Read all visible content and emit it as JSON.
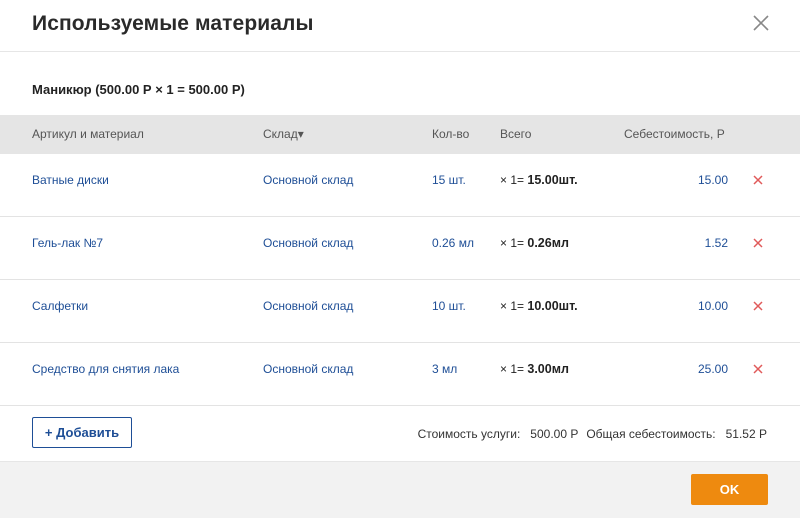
{
  "dialog": {
    "title": "Используемые материалы",
    "service_line": "Маникюр (500.00 Р × 1 = 500.00 Р)"
  },
  "table": {
    "columns": {
      "article": "Артикул и материал",
      "warehouse": "Склад",
      "warehouse_sort_icon": "▾",
      "qty": "Кол-во",
      "total": "Всего",
      "cost": "Себестоимость, Р"
    },
    "rows": [
      {
        "material": "Ватные диски",
        "warehouse": "Основной склад",
        "qty": "15 шт.",
        "mult": "× 1=",
        "total": "15.00шт.",
        "cost": "15.00"
      },
      {
        "material": "Гель-лак №7",
        "warehouse": "Основной склад",
        "qty": "0.26 мл",
        "mult": "× 1=",
        "total": "0.26мл",
        "cost": "1.52"
      },
      {
        "material": "Салфетки",
        "warehouse": "Основной склад",
        "qty": "10 шт.",
        "mult": "× 1=",
        "total": "10.00шт.",
        "cost": "10.00"
      },
      {
        "material": "Средство для снятия лака",
        "warehouse": "Основной склад",
        "qty": "3 мл",
        "mult": "× 1=",
        "total": "3.00мл",
        "cost": "25.00"
      }
    ]
  },
  "footer": {
    "add_label": "+ Добавить",
    "service_cost_label": "Стоимость услуги:",
    "service_cost_value": "500.00 Р",
    "total_cost_label": "Общая себестоимость:",
    "total_cost_value": "51.52 Р"
  },
  "actions": {
    "ok_label": "OK"
  },
  "colors": {
    "link": "#1e4e96",
    "delete": "#e05a5a",
    "ok": "#ee8a0f",
    "table_header_bg": "#e5e5e5"
  },
  "icons": {
    "close": "close-icon",
    "delete": "delete-x-icon",
    "sort": "sort-down-icon"
  }
}
